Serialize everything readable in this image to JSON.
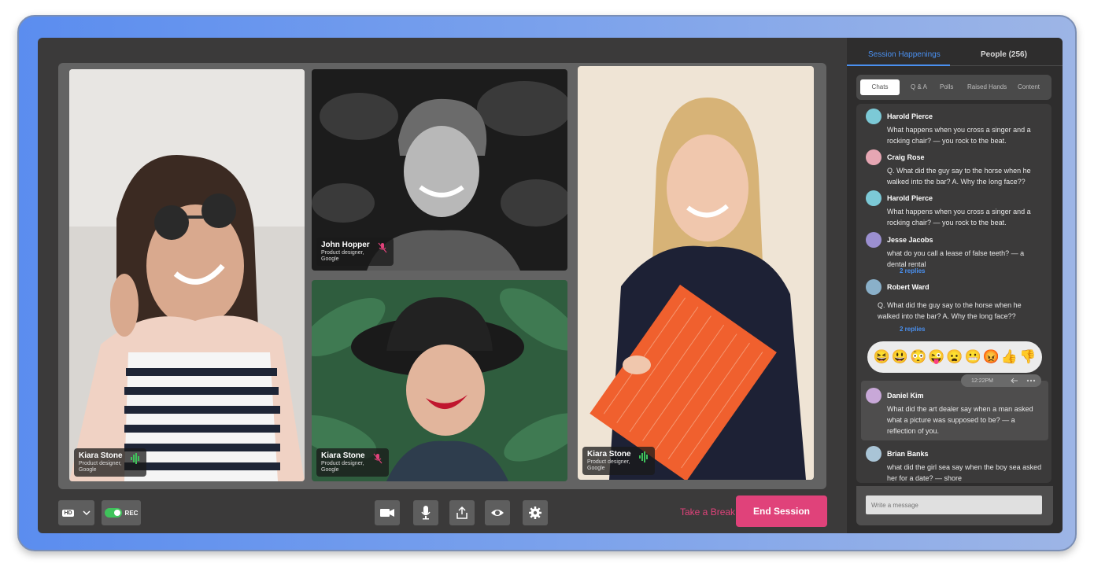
{
  "participants": [
    {
      "name": "Kiara Stone",
      "role": "Product designer, Google",
      "status": "speaking"
    },
    {
      "name": "John Hopper",
      "role": "Product designer, Google",
      "status": "muted"
    },
    {
      "name": "Kiara Stone",
      "role": "Product designer, Google",
      "status": "muted"
    },
    {
      "name": "Kiara Stone",
      "role": "Product designer, Google",
      "status": "speaking"
    }
  ],
  "controls": {
    "quality": "HD",
    "rec_label": "REC",
    "rec_on": true,
    "take_break": "Take a Break",
    "end_session": "End Session",
    "icons": [
      "video-camera-icon",
      "microphone-icon",
      "share-icon",
      "eye-icon",
      "gear-icon"
    ]
  },
  "panel": {
    "tabs": [
      "Session Happenings",
      "People (256)"
    ],
    "active_tab": "Session Happenings",
    "subtabs": [
      "Chats",
      "Q & A",
      "Polls",
      "Raised Hands",
      "Content"
    ],
    "active_subtab": "Chats",
    "messages": [
      {
        "author": "Harold Pierce",
        "text": "What happens when you cross a singer and a rocking chair? — you rock to the beat."
      },
      {
        "author": "Craig Rose",
        "text": "Q. What did the guy say to the horse when he walked into the bar? A. Why the long face??"
      },
      {
        "author": "Harold Pierce",
        "text": "What happens when you cross a singer and a rocking chair? — you rock to the beat."
      },
      {
        "author": "Jesse Jacobs",
        "text": "what do you call a lease of false teeth? — a dental rental",
        "replies": "2 replies"
      },
      {
        "author": "Robert Ward",
        "text": "Q. What did the guy say to the horse when he walked into the bar? A. Why the long face??",
        "replies": "2 replies"
      },
      {
        "author": "Daniel Kim",
        "text": "What did the art dealer say when a man asked what a picture was supposed to be? — a reflection of you.",
        "time": "12:22PM"
      },
      {
        "author": "Brian Banks",
        "text": "what did the girl sea say when the boy sea asked her for a date? — shore"
      }
    ],
    "reactions": [
      "😆",
      "😃",
      "😳",
      "😜",
      "😦",
      "😬",
      "😡",
      "👍",
      "👎"
    ],
    "composer_placeholder": "Write a message"
  },
  "colors": {
    "accent": "#4a90f0",
    "danger": "#e0427a",
    "speaking": "#3fc35b"
  }
}
